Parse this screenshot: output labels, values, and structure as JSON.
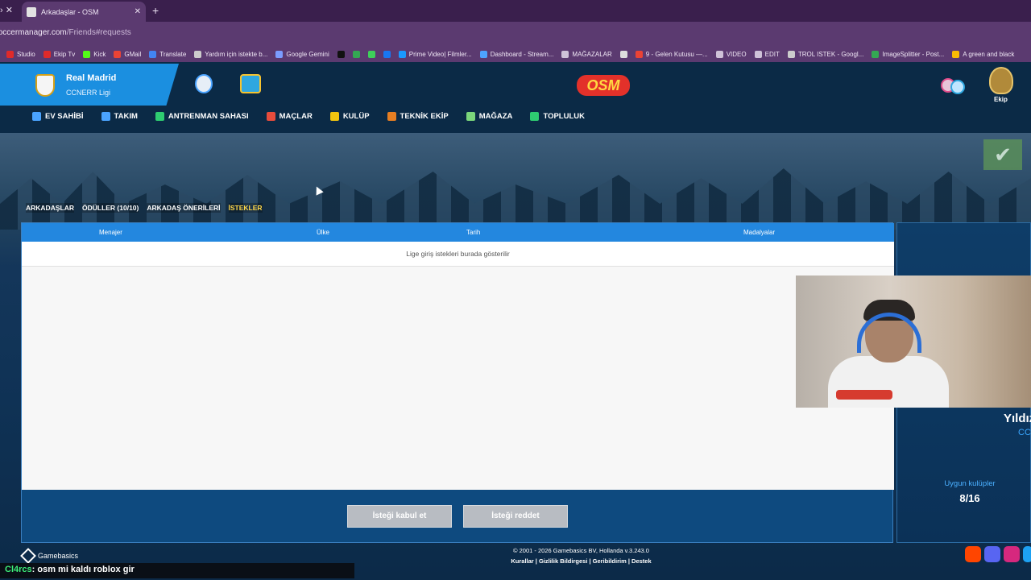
{
  "browser": {
    "tab_title": "Arkadaşlar - OSM",
    "tab_close": "✕",
    "new_tab": "+",
    "url_main": "onlinesoccermanager.com",
    "url_path": "/Friends#requests",
    "bookmarks": [
      {
        "label": "Studio",
        "color": "#e02a2a"
      },
      {
        "label": "Ekip Tv",
        "color": "#e02a2a"
      },
      {
        "label": "Kick",
        "color": "#53fc18"
      },
      {
        "label": "GMail",
        "color": "#ea4335"
      },
      {
        "label": "Translate",
        "color": "#4285f4"
      },
      {
        "label": "Yardım için istekte b...",
        "color": "#cccccc"
      },
      {
        "label": "Google Gemini",
        "color": "#7b9cff"
      },
      {
        "label": "",
        "color": "#111111"
      },
      {
        "label": "",
        "color": "#34a853"
      },
      {
        "label": "",
        "color": "#3ecf5a"
      },
      {
        "label": "",
        "color": "#1877f2"
      },
      {
        "label": "Prime Video| Filmler...",
        "color": "#1a98ff"
      },
      {
        "label": "Dashboard - Stream...",
        "color": "#4da3ff"
      },
      {
        "label": "MAĞAZALAR",
        "color": "#cfc2d8"
      },
      {
        "label": "",
        "color": "#dddddd"
      },
      {
        "label": "9 - Gelen Kutusu —...",
        "color": "#ea4335"
      },
      {
        "label": "VIDEO",
        "color": "#cfc2d8"
      },
      {
        "label": "EDIT",
        "color": "#cfc2d8"
      },
      {
        "label": "TROL ISTEK - Googl...",
        "color": "#cccccc"
      },
      {
        "label": "ImageSplitter - Post...",
        "color": "#34a853"
      },
      {
        "label": "A green and black",
        "color": "#fbbc04"
      }
    ]
  },
  "header": {
    "club_name": "Real Madrid",
    "league_name": "CCNERR Ligi",
    "logo_text": "OSM",
    "crew_label": "Ekip",
    "nav": [
      {
        "label": "EV SAHİBİ",
        "color": "#4aa3ff"
      },
      {
        "label": "TAKIM",
        "color": "#4aa3ff"
      },
      {
        "label": "ANTRENMAN SAHASI",
        "color": "#2ecc71"
      },
      {
        "label": "MAÇLAR",
        "color": "#e74c3c"
      },
      {
        "label": "KULÜP",
        "color": "#f1c40f"
      },
      {
        "label": "TEKNİK EKİP",
        "color": "#e67e22"
      },
      {
        "label": "MAĞAZA",
        "color": "#7bd67b"
      },
      {
        "label": "TOPLULUK",
        "color": "#2ecc71"
      }
    ]
  },
  "subtabs": [
    {
      "label": "ARKADAŞLAR",
      "active": false
    },
    {
      "label": "ÖDÜLLER (10/10)",
      "active": false
    },
    {
      "label": "ARKADAŞ ÖNERİLERİ",
      "active": false
    },
    {
      "label": "İSTEKLER",
      "active": true
    }
  ],
  "table": {
    "columns": [
      "Menajer",
      "Ülke",
      "Tarih",
      "Madalyalar"
    ],
    "empty_message": "Lige giriş istekleri burada gösterilir",
    "accept_button": "İsteği kabul et",
    "reject_button": "İsteği reddet"
  },
  "right_panel": {
    "name": "Yıldız",
    "sub": "CCN",
    "label": "Uygun kulüpler",
    "value": "8/16"
  },
  "footer": {
    "brand": "Gamebasics",
    "copyright": "© 2001 - 2026 Gamebasics BV, Hollanda v.3.243.0",
    "links": "Kurallar | Gizlilik Bildirgesi | Geribildirim | Destek"
  },
  "chat": {
    "user": "Cl4rcs",
    "message": ": osm mi kaldı roblox gir"
  },
  "check_icon": "✔"
}
